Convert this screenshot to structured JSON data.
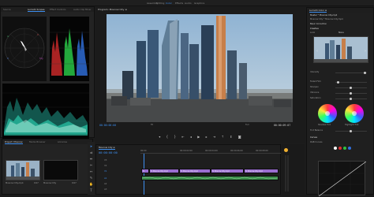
{
  "topbar": {
    "workspaces": [
      "Assembly",
      "Editing",
      "Color",
      "Effects",
      "Audio",
      "Graphics"
    ],
    "active_workspace": "Color"
  },
  "scopes": {
    "tabs": [
      "Source",
      "Lumetri Scopes",
      "Effect Controls",
      "Audio Clip Mixer"
    ],
    "active_tab": "Lumetri Scopes"
  },
  "monitor": {
    "title": "Program: Moscow City ≡",
    "timecode_current": "00:00:00:00",
    "timecode_duration": "00:00:09:07",
    "fit": "Fit",
    "quality": "Full",
    "transport_icons": [
      "marker",
      "in-point",
      "out-point",
      "go-to-in",
      "step-back",
      "play",
      "step-forward",
      "go-to-out",
      "lift",
      "extract",
      "export-frame"
    ]
  },
  "project": {
    "tabs": [
      "Project: Moscow",
      "Media Browser",
      "Libraries"
    ],
    "active_tab": "Project: Moscow",
    "items": [
      {
        "name": "Moscow City.mp4",
        "duration": "9:07"
      },
      {
        "name": "Moscow City",
        "duration": "9:07"
      }
    ]
  },
  "timeline": {
    "title": "Moscow City ≡",
    "timecode": "00:00:00:00",
    "ruler": [
      "00:00",
      "00:00:02:00",
      "00:00:04:00",
      "00:00:06:00",
      "00:00:08:00"
    ],
    "tracks": [
      "V3",
      "V2",
      "V1",
      "A1",
      "A2",
      "A3"
    ],
    "video_clips": [
      "fx",
      "fx Moscow City.mp4",
      "fx Moscow City.mp4",
      "fx Moscow City.mp4",
      "fx Moscow City.mp4"
    ],
    "audio_clips": [
      "",
      "",
      ""
    ]
  },
  "lumetri": {
    "tabs": [
      "Lumetri Color ≡"
    ],
    "source": "Master * Moscow City.mp4",
    "sequence": "Moscow City * Moscow City.mp4",
    "sections": [
      "Basic Correction",
      "Creative",
      "Curves",
      "Color Wheels & Match",
      "HSL Secondary",
      "Vignette"
    ],
    "creative_label": "Look",
    "look_value": "None",
    "adjustments": [
      "Intensity",
      "Faded Film",
      "Sharpen",
      "Vibrance",
      "Saturation"
    ],
    "wheel_labels": [
      "Shadow Tint",
      "Highlight Tint"
    ],
    "tint_balance": "Tint Balance",
    "rgb_curves": "RGB Curves"
  },
  "colors": {
    "accent": "#3d8ff0",
    "clip_video": "#9a6dd0",
    "clip_audio": "#3b8d4a"
  }
}
